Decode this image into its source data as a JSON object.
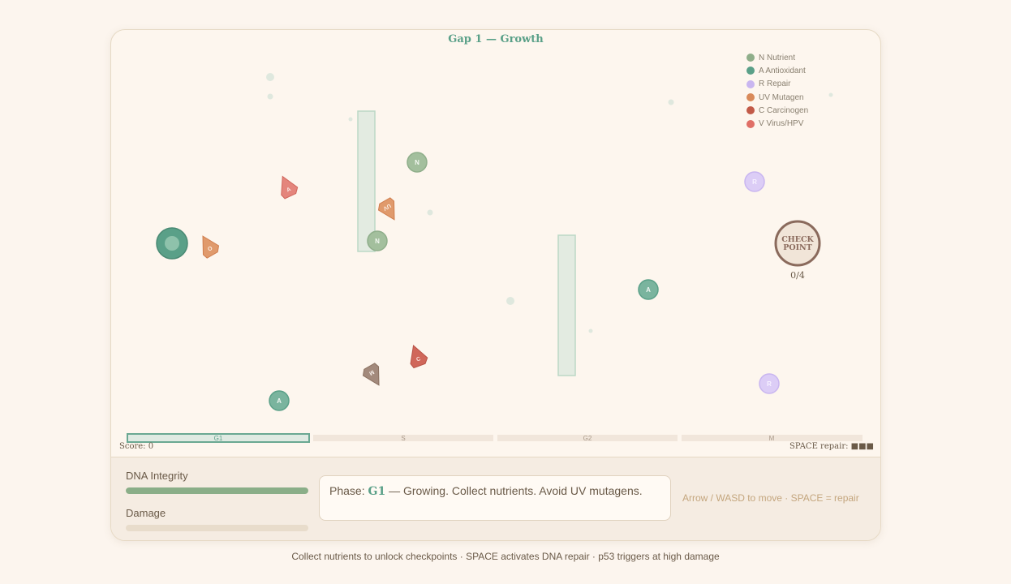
{
  "game": {
    "title": "Gap 1 — Growth",
    "score_text": "Score: 0",
    "repair_hint": "SPACE repair: ■■■",
    "checkpoint": {
      "label_line1": "CHECK",
      "label_line2": "POINT",
      "progress": "0/4"
    }
  },
  "legend": [
    {
      "label": "N Nutrient",
      "color": "#8fae8a"
    },
    {
      "label": "A Antioxidant",
      "color": "#5aa088"
    },
    {
      "label": "R Repair",
      "color": "#c9b6f0"
    },
    {
      "label": "UV Mutagen",
      "color": "#d98a5a"
    },
    {
      "label": "C Carcinogen",
      "color": "#c25a48"
    },
    {
      "label": "V Virus/HPV",
      "color": "#e06f66"
    }
  ],
  "phases": [
    {
      "label": "G1",
      "active": true
    },
    {
      "label": "S",
      "active": false
    },
    {
      "label": "G2",
      "active": false
    },
    {
      "label": "M",
      "active": false
    }
  ],
  "entities": {
    "nutrients": [
      "N",
      "N"
    ],
    "antioxidants": [
      "A",
      "A"
    ],
    "repairs": [
      "R",
      "R"
    ],
    "hazards": [
      "A",
      "UV",
      "O",
      "C",
      "M"
    ]
  },
  "hud": {
    "dna_label": "DNA Integrity",
    "dna_value": 1.0,
    "damage_label": "Damage",
    "damage_value": 0.0,
    "phase_prefix": "Phase: ",
    "phase_name": "G1",
    "phase_desc": " — Growing. Collect nutrients. Avoid UV mutagens.",
    "controls": "Arrow / WASD to move · SPACE = repair"
  },
  "footer": "Collect nutrients to unlock checkpoints · SPACE activates DNA repair · p53 triggers at high damage",
  "colors": {
    "accent": "#5aa088",
    "dna_fill": "#8aae88",
    "damage_fill": "#e8dccb"
  }
}
